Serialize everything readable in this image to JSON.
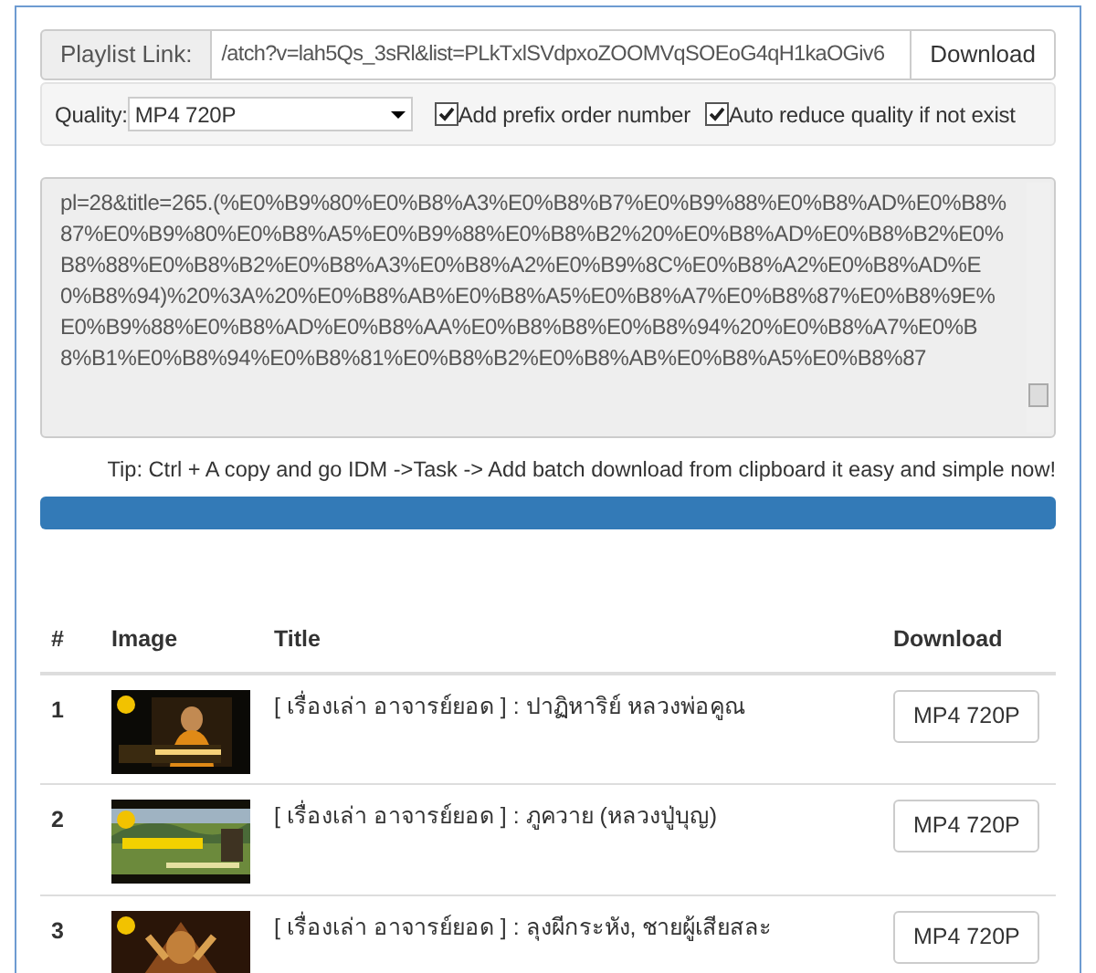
{
  "playlist": {
    "label": "Playlist Link:",
    "value": "/atch?v=lah5Qs_3sRl&list=PLkTxlSVdpxoZOOMVqSOEoG4qH1kaOGiv6",
    "button": "Download"
  },
  "options": {
    "quality_label": "Quality:",
    "quality": "MP4 720P",
    "checkboxes": [
      {
        "label": "Add prefix order number",
        "checked": true
      },
      {
        "label": "Auto reduce quality if not exist",
        "checked": true
      }
    ]
  },
  "output": {
    "value": "pl=28&title=265.(%E0%B9%80%E0%B8%A3%E0%B8%B7%E0%B9%88%E0%B8%AD%E0%B8%87%E0%B9%80%E0%B8%A5%E0%B9%88%E0%B8%B2%20%E0%B8%AD%E0%B8%B2%E0%B8%88%E0%B8%B2%E0%B8%A3%E0%B8%A2%E0%B9%8C%E0%B8%A2%E0%B8%AD%E0%B8%94)%20%3A%20%E0%B8%AB%E0%B8%A5%E0%B8%A7%E0%B8%87%E0%B8%9E%E0%B9%88%E0%B8%AD%E0%B8%AA%E0%B8%B8%E0%B8%94%20%E0%B8%A7%E0%B8%B1%E0%B8%94%E0%B8%81%E0%B8%B2%E0%B8%AB%E0%B8%A5%E0%B8%87"
  },
  "tip": "Tip: Ctrl + A copy and go IDM ->Task -> Add batch download from clipboard it easy and simple now!",
  "progress": {
    "level": 1
  },
  "table": {
    "columns": [
      "#",
      "Image",
      "Title",
      "Download"
    ],
    "rows": [
      {
        "number": "1",
        "title": "[ เรื่องเล่า อาจารย์ยอด ] : ปาฏิหาริย์ หลวงพ่อคูณ",
        "download": "MP4 720P"
      },
      {
        "number": "2",
        "title": "[ เรื่องเล่า อาจารย์ยอด ] : ภูควาย (หลวงปู่บุญ)",
        "download": "MP4 720P"
      },
      {
        "number": "3",
        "title": "[ เรื่องเล่า อาจารย์ยอด ] : ลุงผีกระหัง, ชายผู้เสียสละ",
        "download": "MP4 720P"
      }
    ]
  }
}
